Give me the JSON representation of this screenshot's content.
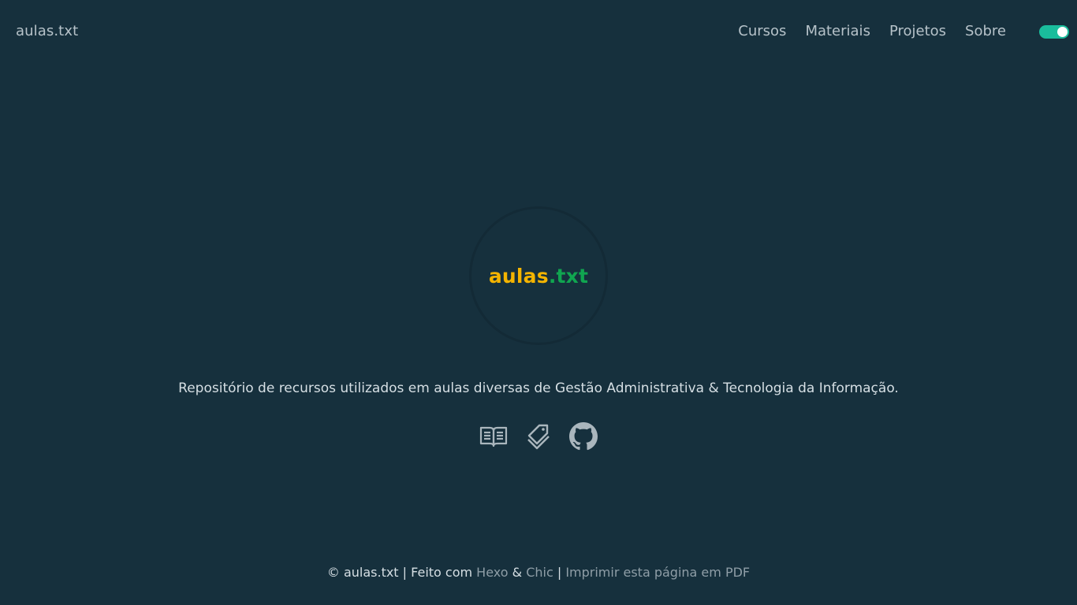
{
  "header": {
    "site_title": "aulas.txt",
    "nav": [
      {
        "label": "Cursos"
      },
      {
        "label": "Materiais"
      },
      {
        "label": "Projetos"
      },
      {
        "label": "Sobre"
      }
    ],
    "theme_toggle": {
      "state": "on",
      "color": "#1abc9c"
    }
  },
  "avatar": {
    "logo_part1": "aulas",
    "logo_part2": ".txt",
    "color_part1": "#f4b400",
    "color_part2": "#10a550"
  },
  "main": {
    "description": "Repositório de recursos utilizados em aulas diversas de Gestão Administrativa & Tecnologia da Informação.",
    "icons": [
      "book-open-icon",
      "tags-icon",
      "github-icon"
    ]
  },
  "footer": {
    "copyright": "© aulas.txt",
    "sep1": " | ",
    "made_with": "Feito com ",
    "hexo": "Hexo",
    "amp": " & ",
    "chic": "Chic",
    "sep2": " | ",
    "print": "Imprimir esta página em PDF"
  },
  "colors": {
    "background": "#16303d",
    "text": "#d6dfe4",
    "muted_link": "#8f9ea7"
  }
}
